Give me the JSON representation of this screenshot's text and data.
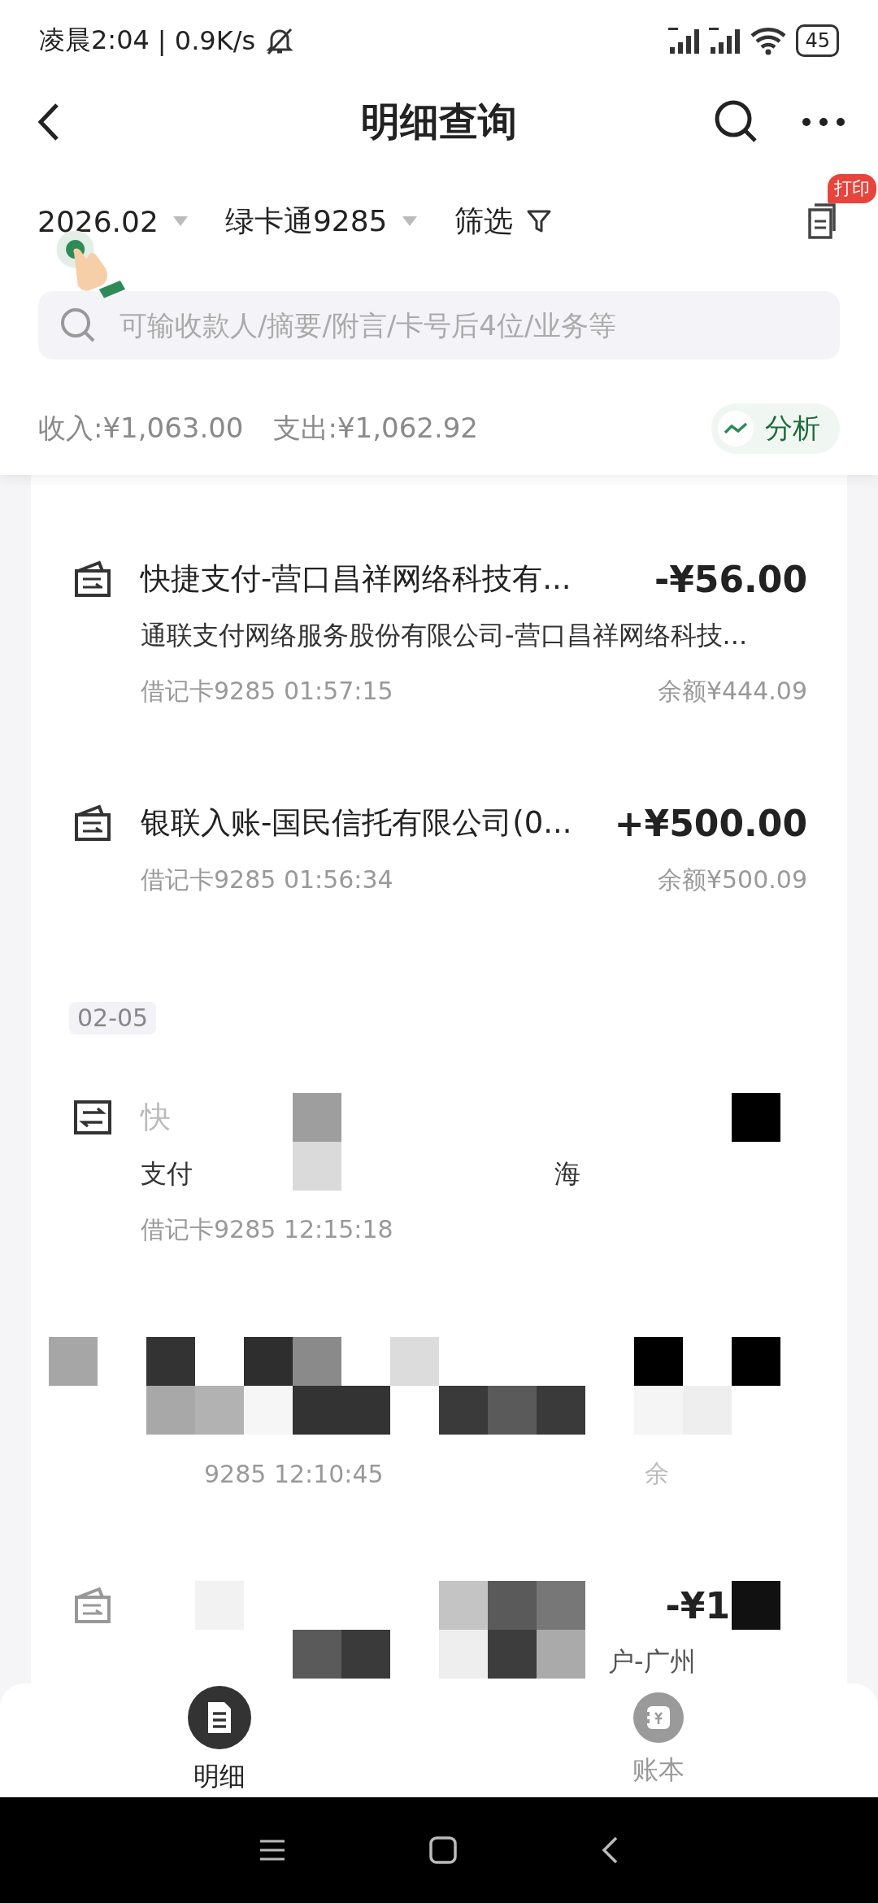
{
  "status_bar": {
    "time": "凌晨2:04",
    "speed": "| 0.9K/s",
    "battery": "45"
  },
  "header": {
    "title": "明细查询"
  },
  "filters": [
    {
      "label": "2026.02",
      "kind": "dropdown"
    },
    {
      "label": "绿卡通9285",
      "kind": "dropdown"
    },
    {
      "label": "筛选",
      "kind": "filter"
    }
  ],
  "print_badge": "打印",
  "search": {
    "placeholder": "可输收款人/摘要/附言/卡号后4位/业务等"
  },
  "summary": {
    "income": "收入:¥1,063.00",
    "expense": "支出:¥1,062.92",
    "analysis_button": "分析"
  },
  "transactions": [
    {
      "kind": "receipt",
      "title": "快捷支付-营口昌祥网络科技有...",
      "amount": "-¥56.00",
      "subtitle": "通联支付网络服务股份有限公司-营口昌祥网络科技...",
      "meta": "借记卡9285 01:57:15",
      "balance": "余额¥444.09"
    },
    {
      "kind": "receipt",
      "title": "银联入账-国民信托有限公司(0...",
      "amount": "+¥500.00",
      "meta": "借记卡9285 01:56:34",
      "balance": "余额¥500.09"
    }
  ],
  "date_chip": "02-05",
  "redacted_transactions": [
    {
      "kind": "transfer",
      "title": "快",
      "subtitle_parts": [
        "支付",
        "海"
      ],
      "meta": "借记卡9285 12:15:18"
    },
    {
      "meta": "9285 12:10:45",
      "balance": "余"
    },
    {
      "kind": "receipt",
      "amount": "-¥1",
      "subtitle_parts": [
        "户-广州"
      ]
    }
  ],
  "bottom_tabs": [
    {
      "label": "明细",
      "kind": "document",
      "selected": true
    },
    {
      "label": "账本",
      "kind": "ledger",
      "selected": false
    }
  ]
}
